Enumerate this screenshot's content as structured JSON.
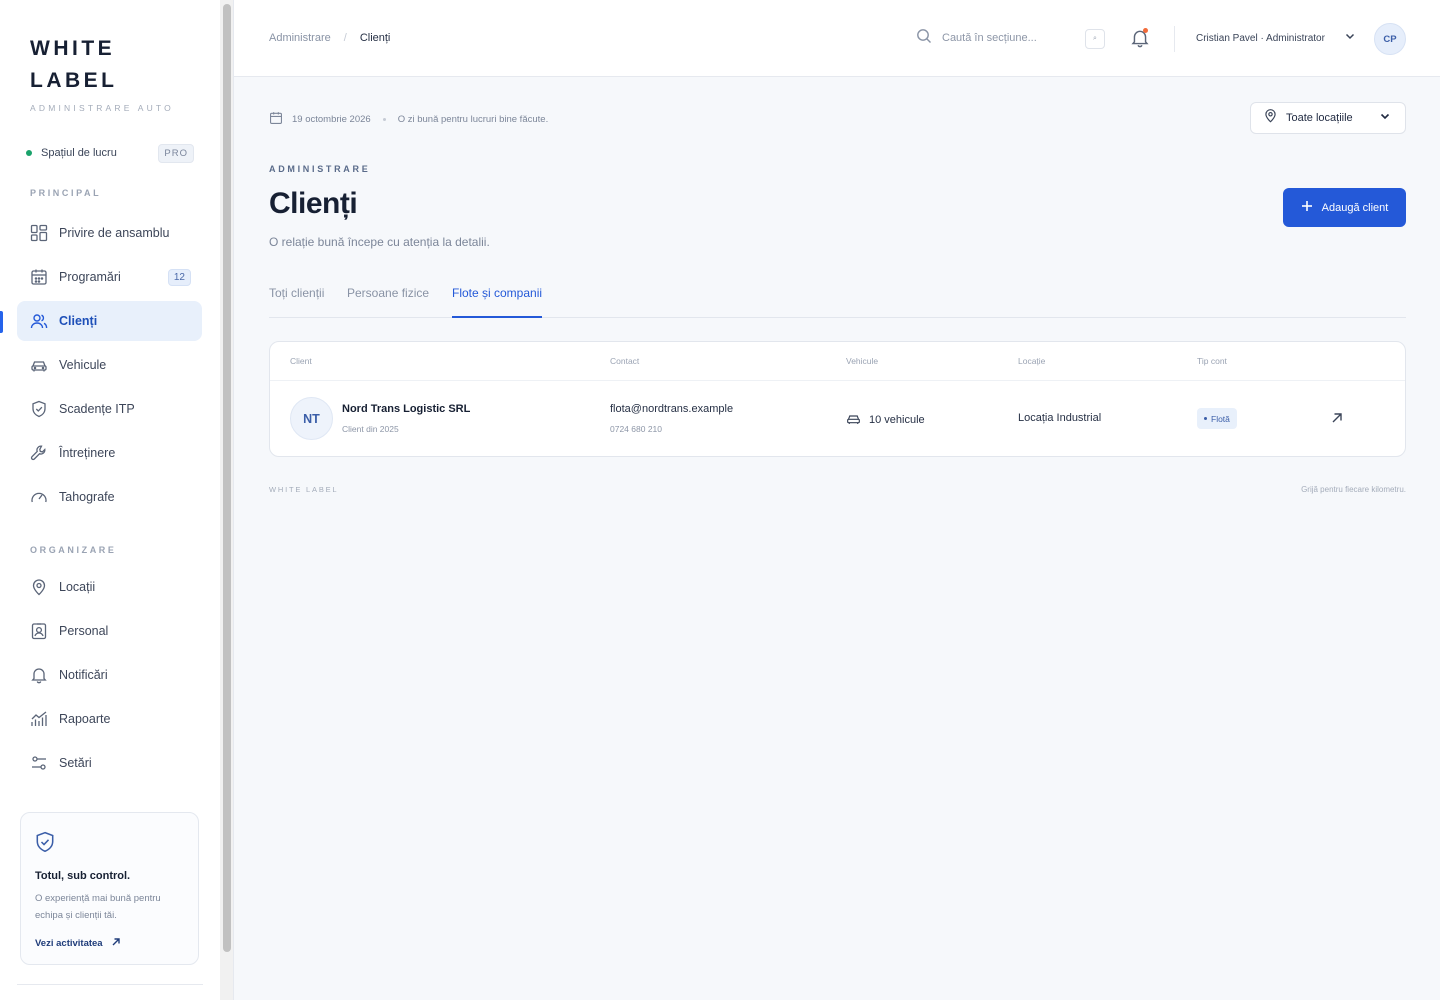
{
  "brand": {
    "title_line1": "WHITE",
    "title_line2": "LABEL",
    "subtitle": "ADMINISTRARE AUTO"
  },
  "workspace": {
    "label": "Spațiul de lucru",
    "badge": "PRO"
  },
  "sidebar": {
    "sections": [
      {
        "label": "PRINCIPAL"
      },
      {
        "label": "ORGANIZARE"
      }
    ],
    "items": [
      {
        "label": "Privire de ansamblu",
        "icon": "grid-icon"
      },
      {
        "label": "Programări",
        "icon": "calendar-icon",
        "count": "12"
      },
      {
        "label": "Clienți",
        "icon": "users-icon",
        "active": true
      },
      {
        "label": "Vehicule",
        "icon": "car-icon"
      },
      {
        "label": "Scadențe ITP",
        "icon": "shield-check-icon"
      },
      {
        "label": "Întreținere",
        "icon": "wrench-icon"
      },
      {
        "label": "Tahografe",
        "icon": "gauge-icon"
      },
      {
        "label": "Locații",
        "icon": "map-pin-icon"
      },
      {
        "label": "Personal",
        "icon": "id-badge-icon"
      },
      {
        "label": "Notificări",
        "icon": "bell-icon"
      },
      {
        "label": "Rapoarte",
        "icon": "chart-icon"
      },
      {
        "label": "Setări",
        "icon": "sliders-icon"
      }
    ],
    "promo": {
      "title": "Totul, sub control.",
      "text": "O experiență mai bună pentru echipa și clienții tăi.",
      "link": "Vezi activitatea"
    }
  },
  "header": {
    "breadcrumb": [
      "Administrare",
      "/",
      "Clienți"
    ],
    "search_placeholder": "Caută în secțiune...",
    "search_shortcut": "⌕",
    "user_name": "Cristian Pavel · Administrator",
    "user_initials": "CP"
  },
  "main": {
    "date": "19 octombrie 2026",
    "greeting": "O zi bună pentru lucruri bine făcute.",
    "location_filter": "Toate locațiile",
    "eyebrow": "ADMINISTRARE",
    "title": "Clienți",
    "subtitle": "O relație bună începe cu atenția la detalii.",
    "add_button": "Adaugă client",
    "tabs": [
      {
        "label": "Toți clienții"
      },
      {
        "label": "Persoane fizice"
      },
      {
        "label": "Flote și companii",
        "active": true
      }
    ],
    "table": {
      "columns": [
        "Client",
        "Contact",
        "Vehicule",
        "Locație",
        "Tip cont"
      ],
      "rows": [
        {
          "initials": "NT",
          "name": "Nord Trans Logistic SRL",
          "since": "Client din 2025",
          "email": "flota@nordtrans.example",
          "phone": "0724 680 210",
          "vehicles": "10 vehicule",
          "location": "Locația Industrial",
          "type": "Flotă"
        }
      ]
    },
    "footer_brand": "WHITE LABEL",
    "footer_tagline": "Grijă pentru fiecare kilometru."
  },
  "colors": {
    "accent": "#2459d8",
    "active_bg": "#e8f0fb",
    "status_dot": "#1aa26b",
    "notification_dot": "#f26b3a"
  }
}
